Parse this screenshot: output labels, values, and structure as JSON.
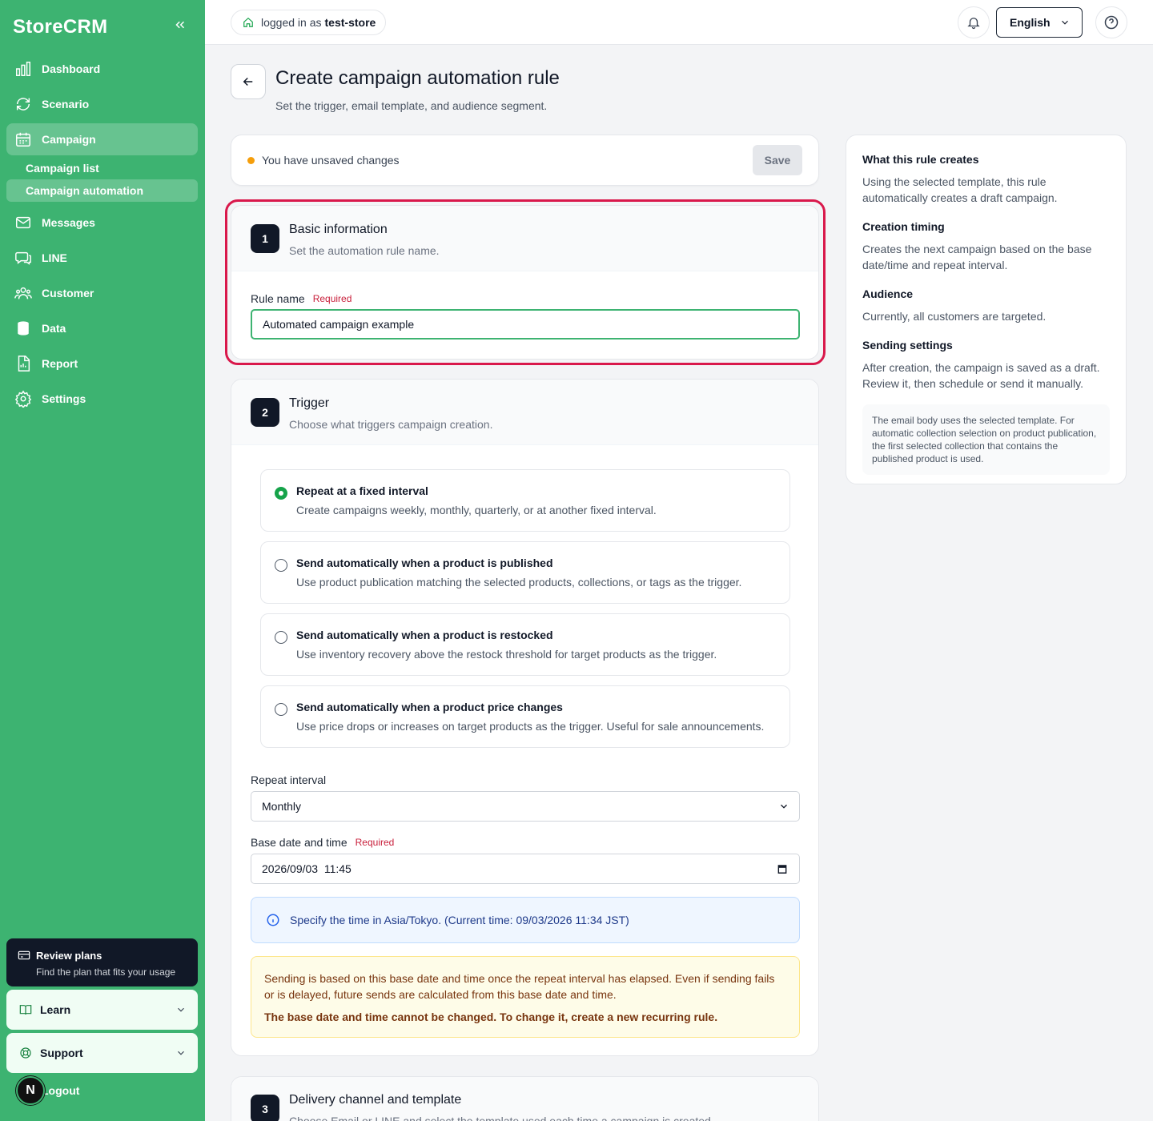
{
  "brand": {
    "name": "StoreCRM",
    "accent": "#3db371"
  },
  "sidebar": {
    "items": [
      {
        "label": "Dashboard",
        "icon": "bar-chart-icon"
      },
      {
        "label": "Scenario",
        "icon": "refresh-icon"
      },
      {
        "label": "Campaign",
        "icon": "calendar-icon",
        "active": true
      },
      {
        "label": "Messages",
        "icon": "mail-icon"
      },
      {
        "label": "LINE",
        "icon": "chat-icon"
      },
      {
        "label": "Customer",
        "icon": "users-icon"
      },
      {
        "label": "Data",
        "icon": "database-icon"
      },
      {
        "label": "Report",
        "icon": "report-icon"
      },
      {
        "label": "Settings",
        "icon": "gear-icon"
      }
    ],
    "campaign_sub": [
      {
        "label": "Campaign list"
      },
      {
        "label": "Campaign automation",
        "active": true
      }
    ],
    "promo": {
      "title": "Review plans",
      "subtitle": "Find the plan that fits your usage"
    },
    "learn": "Learn",
    "support": "Support",
    "avatar_letter": "N",
    "logout": "Logout"
  },
  "topbar": {
    "store_prefix": "logged in as",
    "store_name": "test-store",
    "language": "English"
  },
  "page": {
    "title": "Create campaign automation rule",
    "subtitle": "Set the trigger, email template, and audience segment."
  },
  "unsaved": {
    "text": "You have unsaved changes",
    "save_label": "Save"
  },
  "section1": {
    "num": "1",
    "title": "Basic information",
    "subtitle": "Set the automation rule name.",
    "rule_name_label": "Rule name",
    "required": "Required",
    "rule_name_value": "Automated campaign example"
  },
  "section2": {
    "num": "2",
    "title": "Trigger",
    "subtitle": "Choose what triggers campaign creation.",
    "options": [
      {
        "title": "Repeat at a fixed interval",
        "desc": "Create campaigns weekly, monthly, quarterly, or at another fixed interval.",
        "selected": true
      },
      {
        "title": "Send automatically when a product is published",
        "desc": "Use product publication matching the selected products, collections, or tags as the trigger."
      },
      {
        "title": "Send automatically when a product is restocked",
        "desc": "Use inventory recovery above the restock threshold for target products as the trigger."
      },
      {
        "title": "Send automatically when a product price changes",
        "desc": "Use price drops or increases on target products as the trigger. Useful for sale announcements."
      }
    ],
    "repeat_label": "Repeat interval",
    "repeat_value": "Monthly",
    "base_label": "Base date and time",
    "required": "Required",
    "base_value": "2026/09/03  11:45",
    "timezone_info": "Specify the time in Asia/Tokyo. (Current time: 09/03/2026 11:34 JST)",
    "warning_text": "Sending is based on this base date and time once the repeat interval has elapsed. Even if sending fails or is delayed, future sends are calculated from this base date and time.",
    "warning_bold": "The base date and time cannot be changed. To change it, create a new recurring rule."
  },
  "section3": {
    "num": "3",
    "title": "Delivery channel and template",
    "subtitle": "Choose Email or LINE and select the template used each time a campaign is created."
  },
  "aside": {
    "h1": "What this rule creates",
    "p1": "Using the selected template, this rule automatically creates a draft campaign.",
    "h2": "Creation timing",
    "p2": "Creates the next campaign based on the base date/time and repeat interval.",
    "h3": "Audience",
    "p3": "Currently, all customers are targeted.",
    "h4": "Sending settings",
    "p4": "After creation, the campaign is saved as a draft. Review it, then schedule or send it manually.",
    "note": "The email body uses the selected template. For automatic collection selection on product publication, the first selected collection that contains the published product is used."
  }
}
